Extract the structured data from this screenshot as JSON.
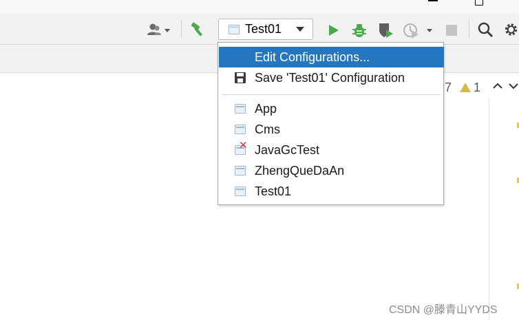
{
  "toolbar": {
    "run_config": "Test01",
    "icons": [
      "user-icon",
      "hammer-icon",
      "run-icon",
      "debug-icon",
      "coverage-icon",
      "profile-icon",
      "stop-icon",
      "search-icon",
      "gear-icon"
    ]
  },
  "menu": {
    "items": [
      {
        "label": "Edit Configurations..."
      },
      {
        "label": "Save 'Test01' Configuration"
      },
      {
        "label": "App"
      },
      {
        "label": "Cms"
      },
      {
        "label": "JavaGcTest"
      },
      {
        "label": "ZhengQueDaAn"
      },
      {
        "label": "Test01"
      }
    ]
  },
  "editor": {
    "inspection_count_a": "7",
    "inspection_count_b": "1"
  },
  "watermark": "CSDN @滕青山YYDS",
  "colors": {
    "selection": "#2675bf",
    "run_green": "#4aa84d",
    "warning": "#e6c84a"
  }
}
